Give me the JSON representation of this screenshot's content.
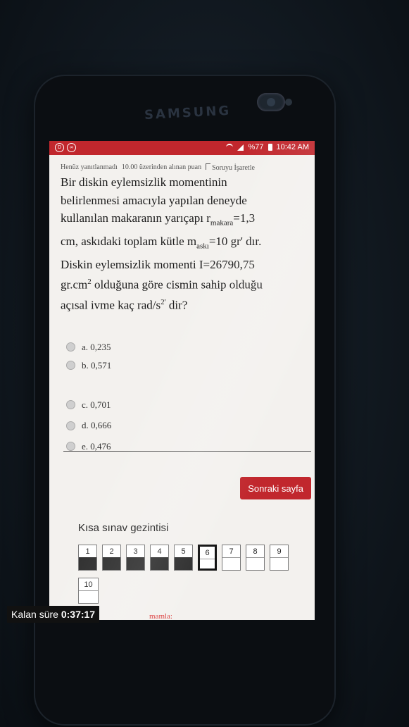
{
  "device": {
    "brand": "SAMSUNG"
  },
  "status_bar": {
    "battery": "%77",
    "time": "10:42 AM"
  },
  "question_meta": {
    "state": "Henüz yanıtlanmadı",
    "points": "10.00 üzerinden alınan puan",
    "flag_label": "Soruyu İşaretle"
  },
  "question": {
    "line1": "Bir diskin eylemsizlik momentinin",
    "line2": "belirlenmesi amacıyla yapılan deneyde",
    "line3_a": "kullanılan makaranın yarıçapı r",
    "line3_sub": "makara",
    "line3_b": "=1,3",
    "line4_a": "cm, askıdaki toplam kütle m",
    "line4_sub": "askı",
    "line4_b": "=10 gr' dır.",
    "line5": "Diskin eylemsizlik momenti I=26790,75",
    "line6_a": "gr.cm",
    "line6_sup": "2",
    "line6_b": " olduğuna göre cismin sahip olduğu",
    "line7_a": "açısal ivme kaç rad/s",
    "line7_sup": "2'",
    "line7_b": " dir?"
  },
  "options": [
    {
      "label": "a. 0,235"
    },
    {
      "label": "b. 0,571"
    },
    {
      "label": "c. 0,701"
    },
    {
      "label": "d. 0,666"
    },
    {
      "label": "e. 0,476"
    }
  ],
  "next_button": "Sonraki sayfa",
  "quiz_nav": {
    "title": "Kısa sınav gezintisi",
    "buttons": [
      {
        "num": "1",
        "state": "answered"
      },
      {
        "num": "2",
        "state": "answered"
      },
      {
        "num": "3",
        "state": "answered"
      },
      {
        "num": "4",
        "state": "answered"
      },
      {
        "num": "5",
        "state": "answered"
      },
      {
        "num": "6",
        "state": "current"
      },
      {
        "num": "7",
        "state": "empty"
      },
      {
        "num": "8",
        "state": "empty"
      },
      {
        "num": "9",
        "state": "empty"
      },
      {
        "num": "10",
        "state": "empty"
      }
    ]
  },
  "timer": {
    "label": "Kalan süre",
    "value": "0:37:17"
  },
  "partial_text": "mamla:",
  "colors": {
    "accent": "#c1272d",
    "screen_bg": "#f3f1ee"
  }
}
